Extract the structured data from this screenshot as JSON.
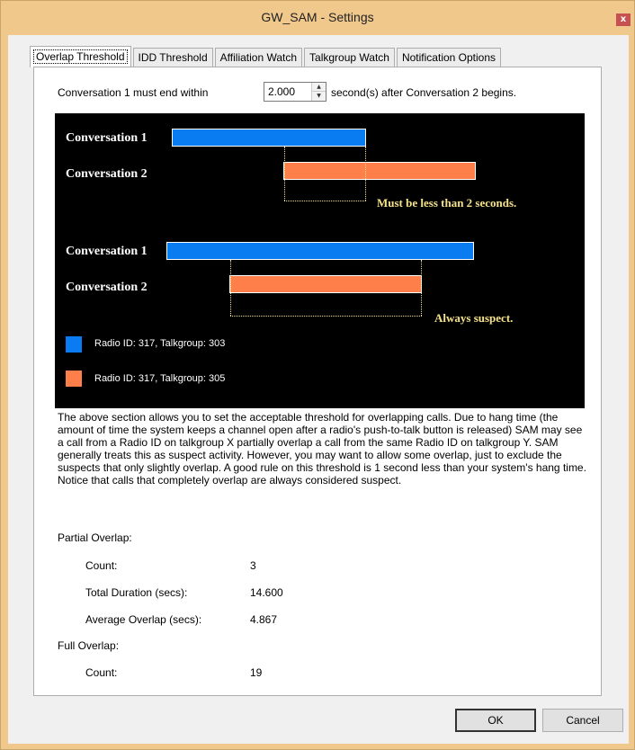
{
  "window": {
    "title": "GW_SAM - Settings",
    "close_glyph": "x"
  },
  "tabs": [
    {
      "label": "Overlap Threshold"
    },
    {
      "label": "IDD Threshold"
    },
    {
      "label": "Affiliation Watch"
    },
    {
      "label": "Talkgroup Watch"
    },
    {
      "label": "Notification Options"
    }
  ],
  "threshold": {
    "prefix": "Conversation 1 must end within",
    "value": "2.000",
    "suffix": "second(s) after Conversation 2 begins."
  },
  "diagram": {
    "example1": {
      "conv1_label": "Conversation 1",
      "conv2_label": "Conversation 2",
      "note": "Must be less than 2 seconds."
    },
    "example2": {
      "conv1_label": "Conversation 1",
      "conv2_label": "Conversation 2",
      "note": "Always suspect."
    },
    "legend": [
      {
        "label": "Radio ID: 317, Talkgroup: 303",
        "color": "#0a7cf2"
      },
      {
        "label": "Radio ID: 317, Talkgroup: 305",
        "color": "#ff7f4a"
      }
    ]
  },
  "description": "The above section allows you to set the acceptable threshold for overlapping calls.  Due to hang time (the amount of time the system keeps a channel open after a radio's push-to-talk button is released) SAM may see a call from a Radio ID on talkgroup X partially overlap a call from the same Radio ID on talkgroup Y.  SAM generally treats this as suspect activity.  However, you may want to allow some overlap, just to exclude the suspects that only slightly overlap.  A good rule on this threshold is 1 second less than your system's hang time.  Notice that calls that completely overlap are always considered suspect.",
  "partial_overlap": {
    "heading": "Partial Overlap:",
    "count_label": "Count:",
    "count_value": "3",
    "total_label": "Total Duration (secs):",
    "total_value": "14.600",
    "avg_label": "Average Overlap (secs):",
    "avg_value": "4.867"
  },
  "full_overlap": {
    "heading": "Full Overlap:",
    "count_label": "Count:",
    "count_value": "19"
  },
  "buttons": {
    "ok": "OK",
    "cancel": "Cancel"
  }
}
